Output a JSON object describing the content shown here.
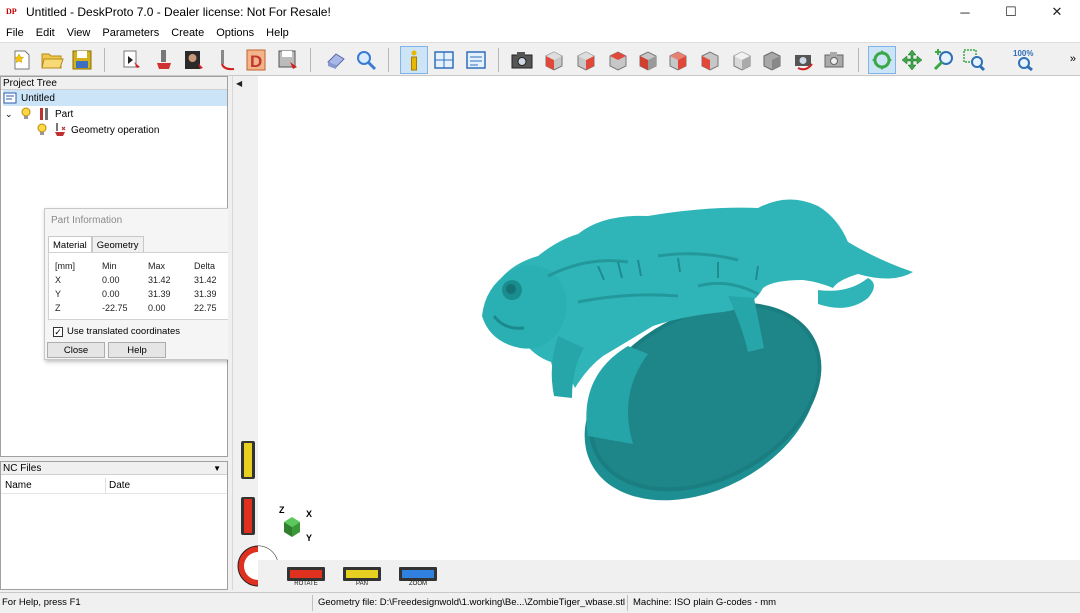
{
  "window": {
    "title": "Untitled - DeskProto 7.0 - Dealer license: Not For Resale!",
    "logo_text": "DP",
    "minimize": "─",
    "maximize": "☐",
    "close": "✕"
  },
  "menu": [
    "File",
    "Edit",
    "View",
    "Parameters",
    "Create",
    "Options",
    "Help"
  ],
  "toolbar": {
    "zoom_percent": "100%",
    "more_glyph": "»"
  },
  "project_tree": {
    "header": "Project Tree",
    "items": [
      {
        "label": "Untitled",
        "icon": "project-icon",
        "selected": true
      },
      {
        "label": "Part",
        "icon": "part-icon"
      },
      {
        "label": "Geometry operation",
        "icon": "geometry-operation-icon"
      }
    ]
  },
  "part_info": {
    "title": "Part Information",
    "tabs": [
      "Material",
      "Geometry"
    ],
    "active_tab": "Material",
    "columns": [
      "[mm]",
      "Min",
      "Max",
      "Delta"
    ],
    "rows": [
      {
        "axis": "X",
        "min": "0.00",
        "max": "31.42",
        "delta": "31.42"
      },
      {
        "axis": "Y",
        "min": "0.00",
        "max": "31.39",
        "delta": "31.39"
      },
      {
        "axis": "Z",
        "min": "-22.75",
        "max": "0.00",
        "delta": "22.75"
      }
    ],
    "checkbox_label": "Use translated coordinates",
    "checkbox_checked": true,
    "check_glyph": "✓",
    "close_label": "Close",
    "help_label": "Help",
    "more_glyph": "▼"
  },
  "nc_files": {
    "header": "NC Files",
    "dropdown_glyph": "▼",
    "columns": [
      "Name",
      "Date"
    ]
  },
  "viewport": {
    "collapse_glyph": "◀",
    "axes": {
      "z": "Z",
      "x": "X",
      "y": "Y"
    },
    "model_color": "#2fb5b8",
    "controls": [
      {
        "label": "ROTATE",
        "color": "#e03020"
      },
      {
        "label": "PAN",
        "color": "#e8d020"
      },
      {
        "label": "ZOOM",
        "color": "#3080e0"
      }
    ]
  },
  "statusbar": {
    "help": "For Help, press F1",
    "geometry_file": "Geometry file: D:\\Freedesignwold\\1.working\\Be...\\ZombieTiger_wbase.stl",
    "machine": "Machine: ISO plain G-codes - mm"
  }
}
